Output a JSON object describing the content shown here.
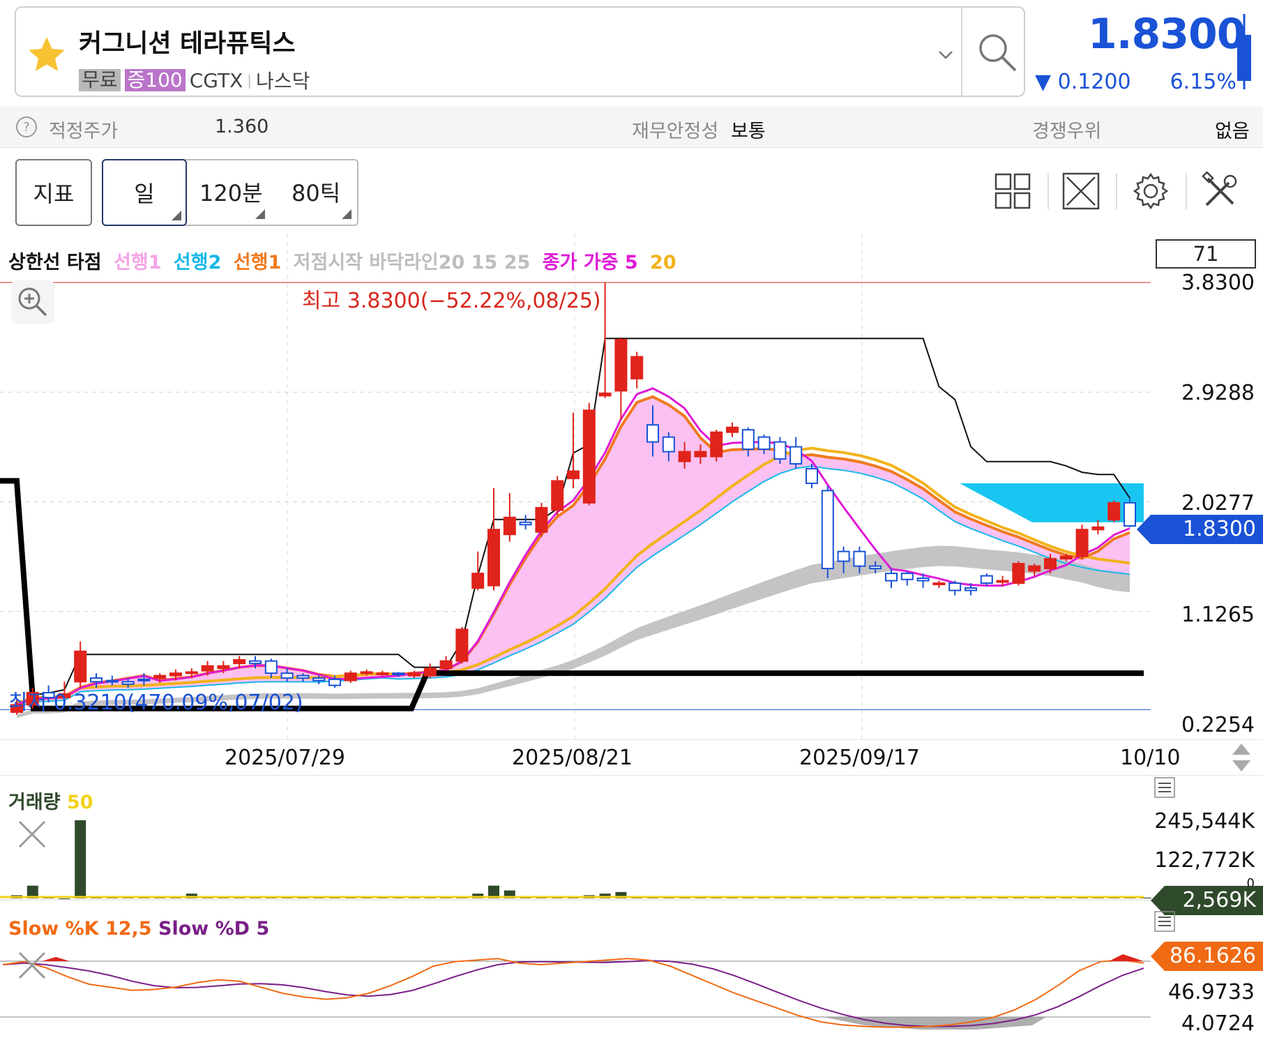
{
  "header": {
    "stock_name": "커그니션 테라퓨틱스",
    "tags": [
      "무료",
      "증100"
    ],
    "ticker": "CGTX",
    "separator": "|",
    "exchange": "나스닥",
    "price": "1.8300",
    "change": "▼ 0.1200",
    "change_pct": "6.15%"
  },
  "info_bar": {
    "fair_price_label": "적정주가",
    "fair_price_value": "1.360",
    "stability_label": "재무안정성",
    "stability_value": "보통",
    "competitive_label": "경쟁우위",
    "competitive_value": "없음"
  },
  "toolbar": {
    "indicator_button": "지표",
    "periods": [
      "일",
      "120분",
      "80틱"
    ],
    "tools": [
      "layout-grid-icon",
      "fullscreen-icon",
      "settings-gear-icon",
      "tools-icon"
    ]
  },
  "legend": {
    "items": [
      {
        "text": "상한선 타점",
        "color": "#111111"
      },
      {
        "text": "선행1",
        "color": "#f5a3e6"
      },
      {
        "text": "선행2",
        "color": "#19b8e8"
      },
      {
        "text": "선행1",
        "color": "#f07a20"
      },
      {
        "text": "저점시작 바닥라인20 15 25",
        "color": "#bdbdbd"
      },
      {
        "text": "종가 가중 5",
        "color": "#e01ad8"
      },
      {
        "text": "20",
        "color": "#f2b21a"
      }
    ],
    "box_value": "71"
  },
  "price_axis": [
    "3.8300",
    "2.9288",
    "2.0277",
    "1.1265",
    "0.2254"
  ],
  "current_price_tag": "1.8300",
  "high_label": "최고 3.8300(−52.22%,08/25)",
  "low_label": "최저 0.3210(470.09%,07/02)",
  "dates": [
    "2025/07/29",
    "2025/08/21",
    "2025/09/17",
    "10/10"
  ],
  "volume": {
    "title": "거래량",
    "period": "50",
    "axis": [
      "245,544K",
      "122,772K",
      "0"
    ],
    "current_tag": "2,569K"
  },
  "stochastic": {
    "k_label": "Slow %K 12,5",
    "d_label": "Slow %D 5",
    "axis": [
      "46.9733",
      "4.0724"
    ],
    "current_tag": "86.1626"
  },
  "colors": {
    "accent_blue": "#1a52d6",
    "up_red": "#e0231b",
    "down_blue": "#1a52d6",
    "volume_green": "#2f4a2b",
    "stoch_orange": "#f06a14"
  },
  "chart_data": {
    "type": "candlestick",
    "ylim": [
      0.2254,
      3.83
    ],
    "candles": [
      {
        "o": 0.3,
        "c": 0.36,
        "h": 0.4,
        "l": 0.28
      },
      {
        "o": 0.36,
        "c": 0.46,
        "h": 0.5,
        "l": 0.33
      },
      {
        "o": 0.46,
        "c": 0.42,
        "h": 0.52,
        "l": 0.38
      },
      {
        "o": 0.42,
        "c": 0.45,
        "h": 0.55,
        "l": 0.4
      },
      {
        "o": 0.55,
        "c": 0.8,
        "h": 0.88,
        "l": 0.5
      },
      {
        "o": 0.58,
        "c": 0.55,
        "h": 0.62,
        "l": 0.5
      },
      {
        "o": 0.56,
        "c": 0.55,
        "h": 0.6,
        "l": 0.52
      },
      {
        "o": 0.55,
        "c": 0.53,
        "h": 0.58,
        "l": 0.5
      },
      {
        "o": 0.57,
        "c": 0.56,
        "h": 0.62,
        "l": 0.52
      },
      {
        "o": 0.58,
        "c": 0.6,
        "h": 0.62,
        "l": 0.54
      },
      {
        "o": 0.6,
        "c": 0.62,
        "h": 0.65,
        "l": 0.56
      },
      {
        "o": 0.62,
        "c": 0.63,
        "h": 0.66,
        "l": 0.58
      },
      {
        "o": 0.64,
        "c": 0.68,
        "h": 0.72,
        "l": 0.6
      },
      {
        "o": 0.66,
        "c": 0.68,
        "h": 0.72,
        "l": 0.62
      },
      {
        "o": 0.7,
        "c": 0.73,
        "h": 0.76,
        "l": 0.66
      },
      {
        "o": 0.72,
        "c": 0.7,
        "h": 0.76,
        "l": 0.66
      },
      {
        "o": 0.72,
        "c": 0.62,
        "h": 0.74,
        "l": 0.58
      },
      {
        "o": 0.62,
        "c": 0.58,
        "h": 0.66,
        "l": 0.55
      },
      {
        "o": 0.6,
        "c": 0.58,
        "h": 0.62,
        "l": 0.55
      },
      {
        "o": 0.58,
        "c": 0.56,
        "h": 0.6,
        "l": 0.53
      },
      {
        "o": 0.57,
        "c": 0.52,
        "h": 0.6,
        "l": 0.5
      },
      {
        "o": 0.56,
        "c": 0.62,
        "h": 0.64,
        "l": 0.54
      },
      {
        "o": 0.62,
        "c": 0.63,
        "h": 0.65,
        "l": 0.6
      },
      {
        "o": 0.62,
        "c": 0.62,
        "h": 0.64,
        "l": 0.6
      },
      {
        "o": 0.62,
        "c": 0.61,
        "h": 0.63,
        "l": 0.59
      },
      {
        "o": 0.6,
        "c": 0.62,
        "h": 0.64,
        "l": 0.58
      },
      {
        "o": 0.6,
        "c": 0.66,
        "h": 0.7,
        "l": 0.58
      },
      {
        "o": 0.66,
        "c": 0.72,
        "h": 0.76,
        "l": 0.64
      },
      {
        "o": 0.72,
        "c": 0.98,
        "h": 1.0,
        "l": 0.7
      },
      {
        "o": 1.32,
        "c": 1.44,
        "h": 1.62,
        "l": 1.3
      },
      {
        "o": 1.34,
        "c": 1.8,
        "h": 2.14,
        "l": 1.3
      },
      {
        "o": 1.76,
        "c": 1.9,
        "h": 2.1,
        "l": 1.7
      },
      {
        "o": 1.86,
        "c": 1.84,
        "h": 1.92,
        "l": 1.8
      },
      {
        "o": 1.78,
        "c": 1.98,
        "h": 2.02,
        "l": 1.74
      },
      {
        "o": 1.96,
        "c": 2.2,
        "h": 2.24,
        "l": 1.92
      },
      {
        "o": 2.22,
        "c": 2.28,
        "h": 2.76,
        "l": 2.14
      },
      {
        "o": 2.02,
        "c": 2.78,
        "h": 2.84,
        "l": 2.0
      },
      {
        "o": 2.9,
        "c": 2.92,
        "h": 3.83,
        "l": 2.88
      },
      {
        "o": 2.94,
        "c": 3.36,
        "h": 3.38,
        "l": 2.7
      },
      {
        "o": 3.04,
        "c": 3.22,
        "h": 3.26,
        "l": 2.96
      },
      {
        "o": 2.66,
        "c": 2.52,
        "h": 2.82,
        "l": 2.4
      },
      {
        "o": 2.56,
        "c": 2.44,
        "h": 2.6,
        "l": 2.36
      },
      {
        "o": 2.36,
        "c": 2.44,
        "h": 2.52,
        "l": 2.3
      },
      {
        "o": 2.4,
        "c": 2.44,
        "h": 2.5,
        "l": 2.34
      },
      {
        "o": 2.4,
        "c": 2.6,
        "h": 2.62,
        "l": 2.36
      },
      {
        "o": 2.6,
        "c": 2.64,
        "h": 2.68,
        "l": 2.56
      },
      {
        "o": 2.62,
        "c": 2.46,
        "h": 2.64,
        "l": 2.4
      },
      {
        "o": 2.56,
        "c": 2.46,
        "h": 2.58,
        "l": 2.42
      },
      {
        "o": 2.52,
        "c": 2.38,
        "h": 2.56,
        "l": 2.34
      },
      {
        "o": 2.48,
        "c": 2.34,
        "h": 2.56,
        "l": 2.3
      },
      {
        "o": 2.3,
        "c": 2.18,
        "h": 2.34,
        "l": 2.14
      },
      {
        "o": 2.12,
        "c": 1.48,
        "h": 2.16,
        "l": 1.4
      },
      {
        "o": 1.62,
        "c": 1.54,
        "h": 1.66,
        "l": 1.44
      },
      {
        "o": 1.62,
        "c": 1.5,
        "h": 1.66,
        "l": 1.44
      },
      {
        "o": 1.5,
        "c": 1.48,
        "h": 1.54,
        "l": 1.44
      },
      {
        "o": 1.44,
        "c": 1.38,
        "h": 1.48,
        "l": 1.32
      },
      {
        "o": 1.44,
        "c": 1.39,
        "h": 1.46,
        "l": 1.34
      },
      {
        "o": 1.4,
        "c": 1.38,
        "h": 1.44,
        "l": 1.32
      },
      {
        "o": 1.36,
        "c": 1.36,
        "h": 1.38,
        "l": 1.32
      },
      {
        "o": 1.36,
        "c": 1.3,
        "h": 1.38,
        "l": 1.26
      },
      {
        "o": 1.32,
        "c": 1.3,
        "h": 1.36,
        "l": 1.26
      },
      {
        "o": 1.42,
        "c": 1.36,
        "h": 1.44,
        "l": 1.34
      },
      {
        "o": 1.38,
        "c": 1.38,
        "h": 1.42,
        "l": 1.34
      },
      {
        "o": 1.36,
        "c": 1.52,
        "h": 1.54,
        "l": 1.34
      },
      {
        "o": 1.46,
        "c": 1.5,
        "h": 1.52,
        "l": 1.42
      },
      {
        "o": 1.48,
        "c": 1.56,
        "h": 1.6,
        "l": 1.44
      },
      {
        "o": 1.56,
        "c": 1.58,
        "h": 1.6,
        "l": 1.54
      },
      {
        "o": 1.58,
        "c": 1.8,
        "h": 1.84,
        "l": 1.56
      },
      {
        "o": 1.8,
        "c": 1.82,
        "h": 1.88,
        "l": 1.76
      },
      {
        "o": 1.88,
        "c": 2.02,
        "h": 2.04,
        "l": 1.86
      },
      {
        "o": 2.02,
        "c": 1.83,
        "h": 2.06,
        "l": 1.82
      }
    ],
    "volume_values": [
      4,
      16,
      2,
      0,
      98,
      1,
      1,
      1,
      1,
      1,
      1,
      6,
      1,
      1,
      1,
      1,
      1,
      1,
      1,
      1,
      1,
      1,
      1,
      1,
      1,
      1,
      1,
      1,
      2,
      6,
      16,
      10,
      2,
      2,
      2,
      2,
      4,
      6,
      8,
      3,
      2,
      2,
      2,
      1,
      2,
      2,
      2,
      2,
      2,
      2,
      2,
      3,
      1,
      1,
      1,
      1,
      1,
      1,
      1,
      1,
      1,
      1,
      1,
      1,
      1,
      1,
      1,
      1,
      1,
      1,
      1,
      1
    ]
  }
}
